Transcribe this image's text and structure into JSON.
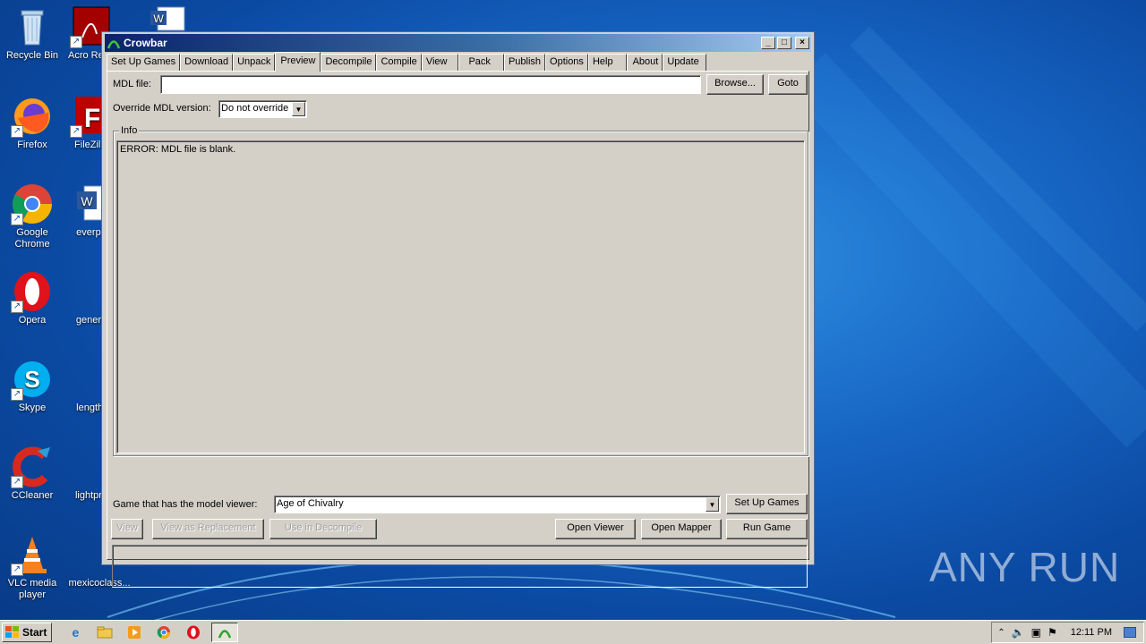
{
  "desktop": {
    "icons": [
      {
        "label": "Recycle Bin"
      },
      {
        "label": "Firefox"
      },
      {
        "label": "Google Chrome"
      },
      {
        "label": "Opera"
      },
      {
        "label": "Skype"
      },
      {
        "label": "CCleaner"
      },
      {
        "label": "VLC media player"
      },
      {
        "label": "Acro Read"
      },
      {
        "label": "FileZilla"
      },
      {
        "label": "everpu"
      },
      {
        "label": "genera"
      },
      {
        "label": "lengthr"
      },
      {
        "label": "lightpro"
      },
      {
        "label": "mexicoclass..."
      }
    ],
    "watermark": "ANY RUN"
  },
  "window": {
    "title": "Crowbar",
    "tabs": [
      "Set Up Games",
      "Download",
      "Unpack",
      "Preview",
      "Decompile",
      "Compile",
      "View",
      "Pack",
      "Publish",
      "Options",
      "Help",
      "About",
      "Update"
    ],
    "active_tab": "Preview",
    "mdl_file_label": "MDL file:",
    "mdl_file_value": "",
    "browse_label": "Browse...",
    "goto_label": "Goto",
    "override_label": "Override MDL version:",
    "override_value": "Do not override",
    "info_legend": "Info",
    "info_text": "ERROR: MDL file is blank.",
    "game_label": "Game that has the model viewer:",
    "game_value": "Age of Chivalry",
    "setup_games_label": "Set Up Games",
    "view_label": "View",
    "view_replacement_label": "View as Replacement",
    "use_decompile_label": "Use in Decompile",
    "open_viewer_label": "Open Viewer",
    "open_mapper_label": "Open Mapper",
    "run_game_label": "Run Game"
  },
  "taskbar": {
    "start_label": "Start",
    "clock": "12:11 PM"
  }
}
